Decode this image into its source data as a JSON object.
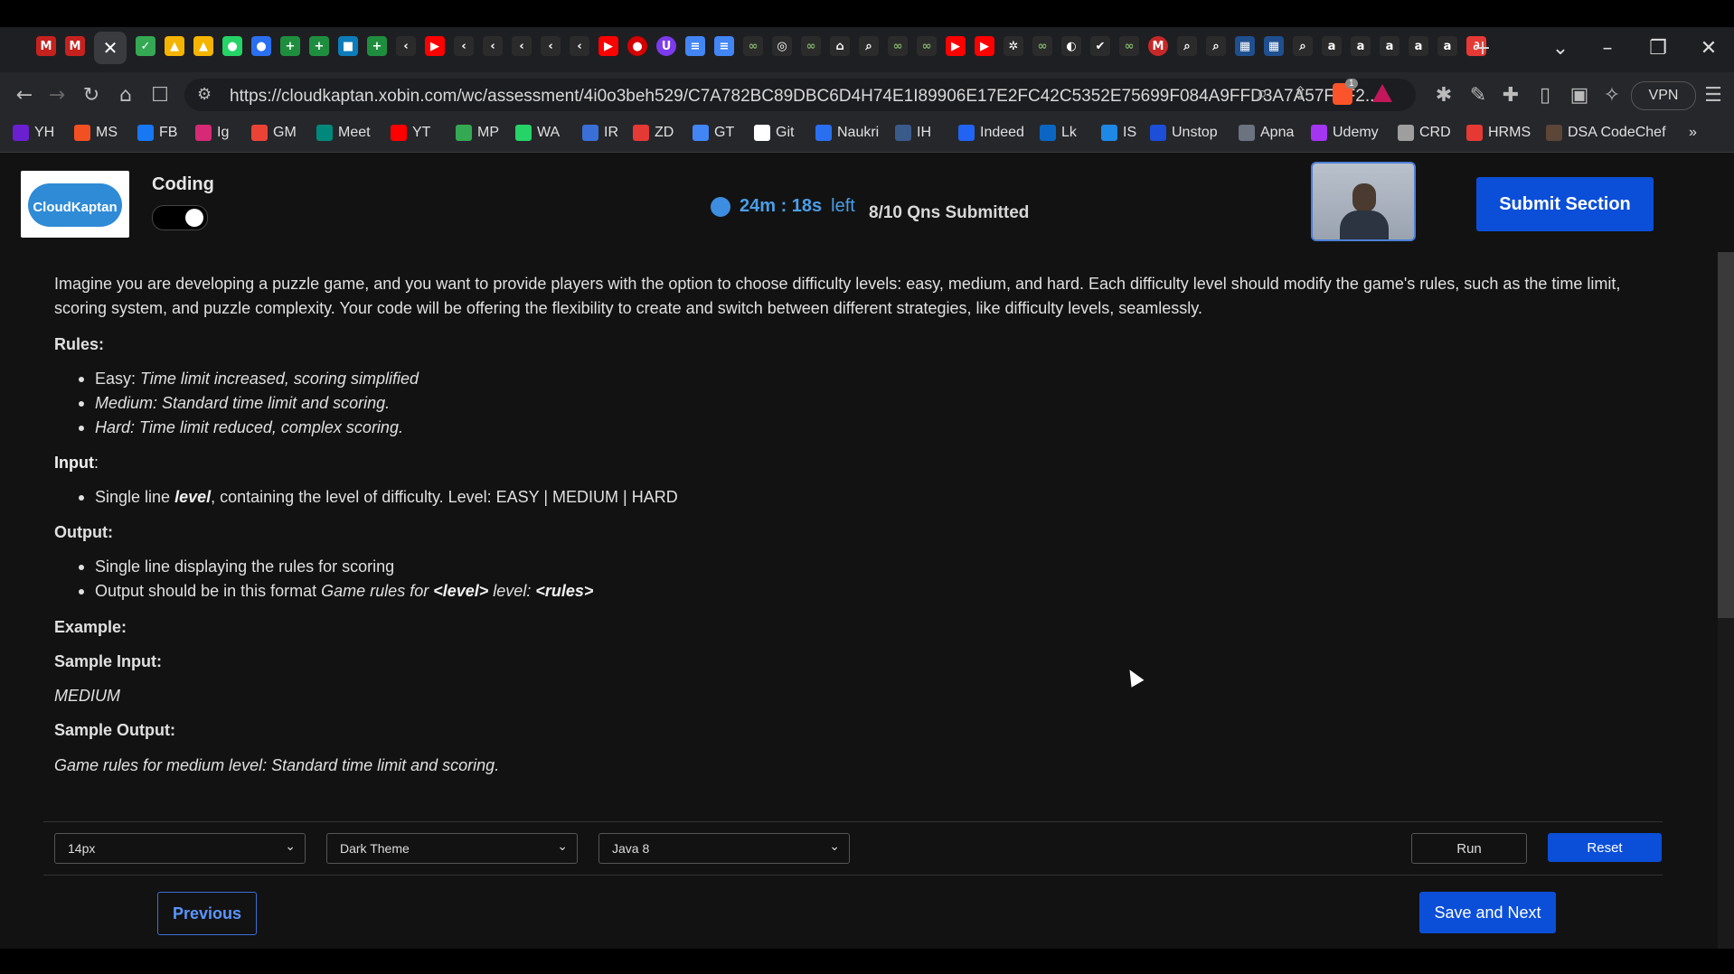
{
  "browser": {
    "url": "https://cloudkaptan.xobin.com/wc/assessment/4i0o3beh529/C7A782BC89DBC6D4H74E1I89906E17E2FC42C5352E75699F084A9FFD3A7A57FAF2...",
    "vpn_label": "VPN",
    "brave_badge": "1",
    "bookmarks": [
      {
        "label": "YH",
        "color": "#6a1fd1"
      },
      {
        "label": "MS",
        "color": "#f25022"
      },
      {
        "label": "FB",
        "color": "#1877f2"
      },
      {
        "label": "Ig",
        "color": "#d62976"
      },
      {
        "label": "GM",
        "color": "#ea4335"
      },
      {
        "label": "Meet",
        "color": "#00897b"
      },
      {
        "label": "YT",
        "color": "#ff0000"
      },
      {
        "label": "MP",
        "color": "#34a853"
      },
      {
        "label": "WA",
        "color": "#25d366"
      },
      {
        "label": "IR",
        "color": "#3b6fd8"
      },
      {
        "label": "ZD",
        "color": "#e53935"
      },
      {
        "label": "GT",
        "color": "#4285f4"
      },
      {
        "label": "Git",
        "color": "#ffffff"
      },
      {
        "label": "Naukri",
        "color": "#2a6ff0"
      },
      {
        "label": "IH",
        "color": "#3a5a8a"
      },
      {
        "label": "Indeed",
        "color": "#2164f3"
      },
      {
        "label": "Lk",
        "color": "#0a66c2"
      },
      {
        "label": "IS",
        "color": "#1e88e5"
      },
      {
        "label": "Unstop",
        "color": "#1d4ed8"
      },
      {
        "label": "Apna",
        "color": "#6b7280"
      },
      {
        "label": "Udemy",
        "color": "#a435f0"
      },
      {
        "label": "CRD",
        "color": "#9e9e9e"
      },
      {
        "label": "HRMS",
        "color": "#e53935"
      },
      {
        "label": "DSA CodeChef",
        "color": "#5b4638"
      }
    ]
  },
  "header": {
    "logo_text": "CloudKaptan",
    "section_title": "Coding",
    "timer": "24m : 18s",
    "timer_suffix": "left",
    "questions_status": "8/10 Qns Submitted",
    "submit_label": "Submit Section"
  },
  "question": {
    "intro_line1": "Imagine you are developing a puzzle game, and you want to provide players with the option to choose difficulty levels: easy, medium, and hard. Each difficulty level should modify the game's rules, such as the time limit,",
    "intro_line2": "scoring system, and puzzle complexity. Your code will be offering the flexibility to create and switch between different strategies, like difficulty levels, seamlessly.",
    "rules_heading": "Rules:",
    "rule_easy_prefix": "Easy:",
    "rule_easy_text": "Time limit increased, scoring simplified",
    "rule_medium": "Medium: Standard time limit and scoring.",
    "rule_hard": "Hard: Time limit reduced, complex scoring.",
    "input_heading": "Input",
    "input_colon": ":",
    "input_item_prefix": "Single line",
    "input_item_var": "level",
    "input_item_rest": ", containing the level of difficulty. Level: EASY | MEDIUM | HARD",
    "output_heading": "Output:",
    "output_item1": "Single line displaying the rules for scoring",
    "output_item2_prefix": "Output should be in this format",
    "output_item2_a": "Game rules for",
    "output_item2_b": "<level>",
    "output_item2_c": "level:",
    "output_item2_d": "<rules>",
    "example_heading": "Example:",
    "sample_input_heading": "Sample Input:",
    "sample_input": "MEDIUM",
    "sample_output_heading": "Sample Output:",
    "sample_output": "Game rules for medium level: Standard time limit and scoring."
  },
  "editor": {
    "font_size": "14px",
    "theme": "Dark Theme",
    "language": "Java 8",
    "run_label": "Run",
    "reset_label": "Reset"
  },
  "nav": {
    "previous_label": "Previous",
    "next_label": "Save and Next"
  },
  "colors": {
    "accent": "#0b4fd8",
    "timer": "#4a9ee8",
    "background": "#121212"
  }
}
